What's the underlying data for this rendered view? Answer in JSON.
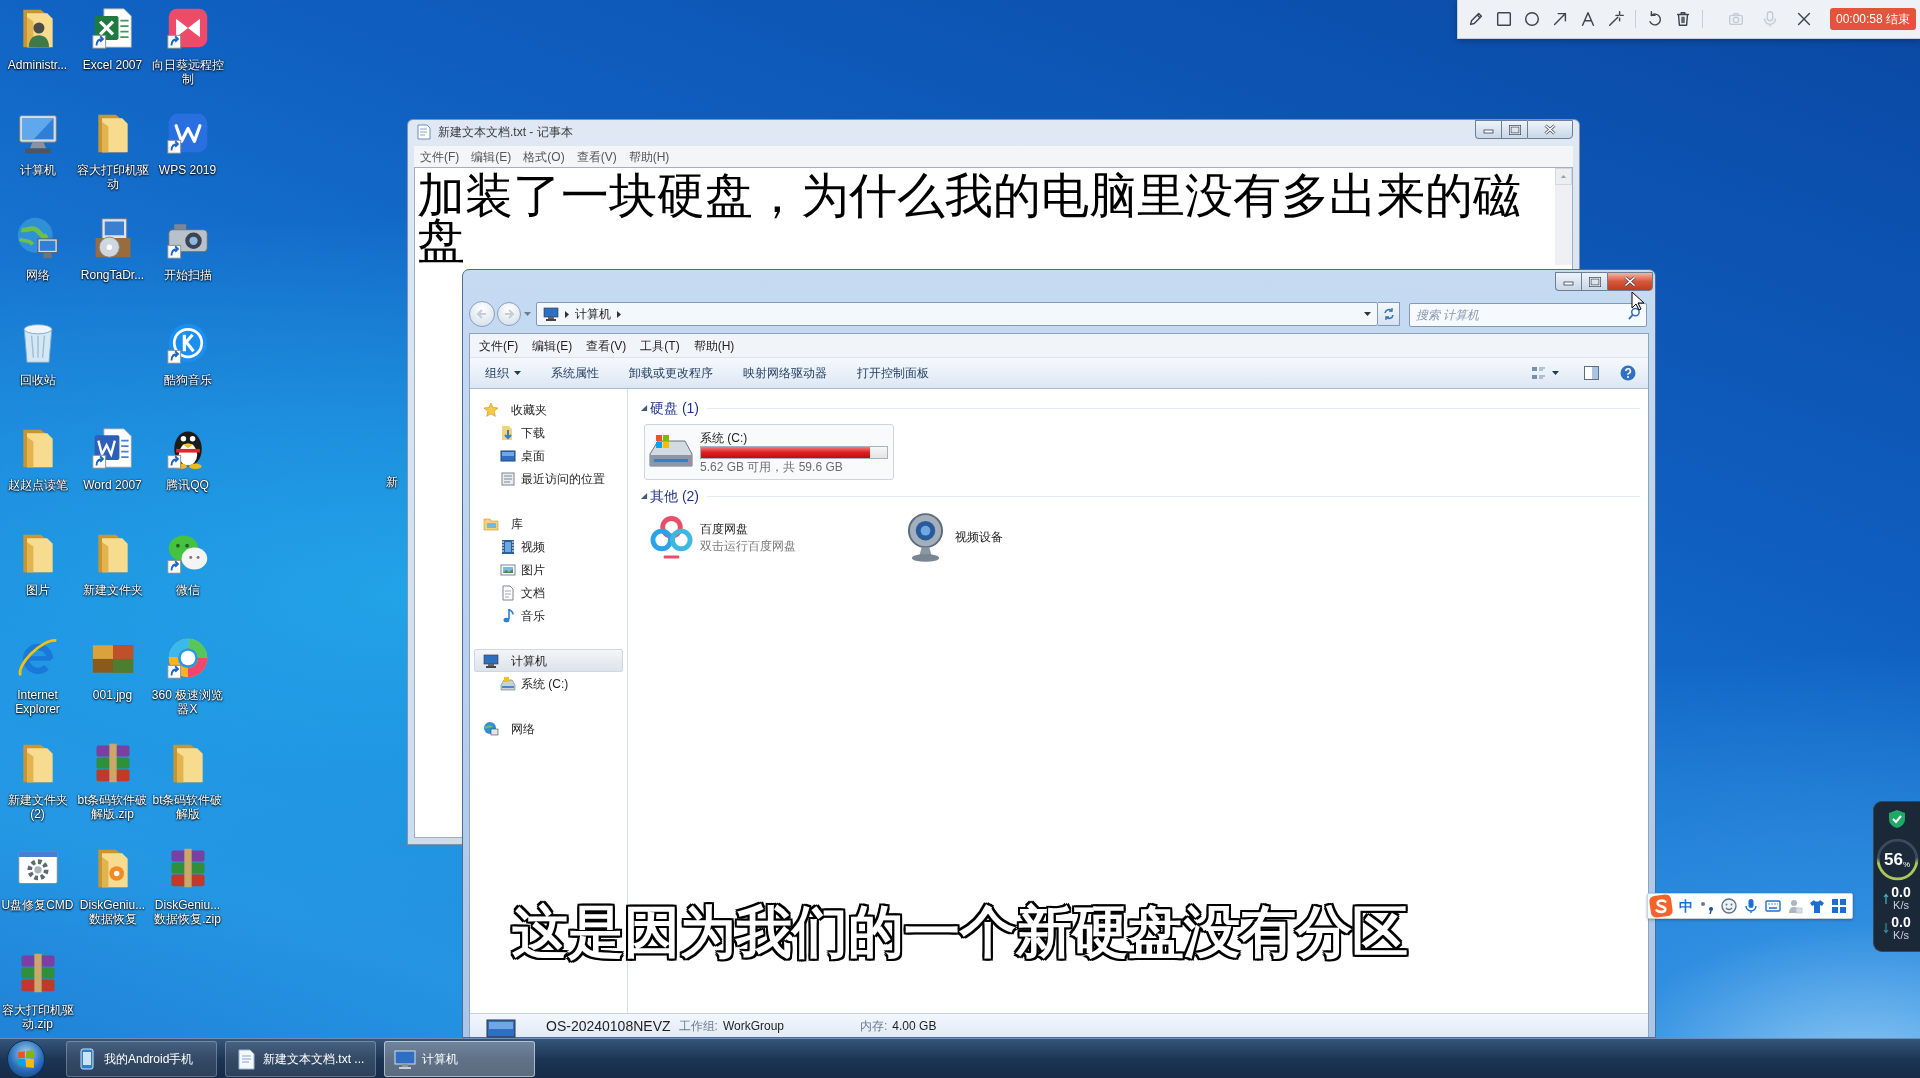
{
  "recorder_toolbar": {
    "tool_groups": [
      [
        {
          "kind": "pencil",
          "disabled": false
        },
        {
          "kind": "rectangle",
          "disabled": false
        },
        {
          "kind": "ellipse",
          "disabled": false
        },
        {
          "kind": "arrow",
          "disabled": false
        },
        {
          "kind": "text",
          "disabled": false
        },
        {
          "kind": "wand",
          "disabled": false
        }
      ],
      [
        {
          "kind": "undo",
          "disabled": false
        },
        {
          "kind": "trash",
          "disabled": false
        }
      ],
      [
        {
          "kind": "camera",
          "disabled": true
        },
        {
          "kind": "microphone",
          "disabled": true
        },
        {
          "kind": "close",
          "disabled": false
        }
      ]
    ],
    "timer_button": "00:00:58 结束"
  },
  "desktop_icon_rows": [
    [
      {
        "label": "Administr...",
        "kind": "user-folder",
        "shortcut": false
      },
      {
        "label": "Excel 2007",
        "kind": "excel",
        "shortcut": true
      },
      {
        "label": "向日葵远程控制",
        "kind": "remote",
        "shortcut": true
      }
    ],
    [
      {
        "label": "计算机",
        "kind": "computer",
        "shortcut": false
      },
      {
        "label": "容大打印机驱动",
        "kind": "folder",
        "shortcut": false
      },
      {
        "label": "WPS 2019",
        "kind": "wps",
        "shortcut": true
      }
    ],
    [
      {
        "label": "网络",
        "kind": "network",
        "shortcut": false
      },
      {
        "label": "RongTaDr...",
        "kind": "installer",
        "shortcut": false
      },
      {
        "label": "开始扫描",
        "kind": "scanner",
        "shortcut": true
      }
    ],
    [
      {
        "label": "回收站",
        "kind": "recycle-bin",
        "shortcut": false
      },
      {
        "kind": "empty"
      },
      {
        "label": "酷狗音乐",
        "kind": "music",
        "shortcut": true
      }
    ],
    [
      {
        "label": "赵赵点读笔",
        "kind": "folder",
        "shortcut": false
      },
      {
        "label": "Word 2007",
        "kind": "word",
        "shortcut": true
      },
      {
        "label": "腾讯QQ",
        "kind": "penguin",
        "shortcut": true
      }
    ],
    [
      {
        "label": "图片",
        "kind": "folder",
        "shortcut": false
      },
      {
        "label": "新建文件夹",
        "kind": "folder",
        "shortcut": false
      },
      {
        "label": "微信",
        "kind": "chat",
        "shortcut": true
      }
    ],
    [
      {
        "label": "Internet Explorer",
        "kind": "ie",
        "shortcut": false
      },
      {
        "label": "001.jpg",
        "kind": "photo",
        "shortcut": false
      },
      {
        "label": "360 极速浏览器X",
        "kind": "ring-browser",
        "shortcut": true
      }
    ],
    [
      {
        "label": "新建文件夹 (2)",
        "kind": "folder",
        "shortcut": false
      },
      {
        "label": "bt条码软件破解版.zip",
        "kind": "archive",
        "shortcut": false
      },
      {
        "label": "bt条码软件破解版",
        "kind": "folder",
        "shortcut": false
      }
    ],
    [
      {
        "label": "U盘修复CMD",
        "kind": "cmd",
        "shortcut": false
      },
      {
        "label": "DiskGeniu... 数据恢复",
        "kind": "disk-folder",
        "shortcut": false
      },
      {
        "label": "DiskGeniu... 数据恢复.zip",
        "kind": "archive",
        "shortcut": false
      }
    ],
    [
      {
        "label": "容大打印机驱动.zip",
        "kind": "archive",
        "shortcut": false
      }
    ]
  ],
  "partial_desktop_label": "新",
  "notepad": {
    "title": "新建文本文档.txt - 记事本",
    "active": false,
    "menu": [
      "文件(F)",
      "编辑(E)",
      "格式(O)",
      "查看(V)",
      "帮助(H)"
    ],
    "text": "加装了一块硬盘，为什么我的电脑里没有多出来的磁盘"
  },
  "explorer": {
    "active": true,
    "address": {
      "crumbs": [
        "计算机"
      ]
    },
    "search": {
      "placeholder": "搜索 计算机"
    },
    "menu": [
      "文件(F)",
      "编辑(E)",
      "查看(V)",
      "工具(T)",
      "帮助(H)"
    ],
    "commands": [
      {
        "label": "组织",
        "dropdown": true
      },
      {
        "label": "系统属性",
        "dropdown": false
      },
      {
        "label": "卸载或更改程序",
        "dropdown": false
      },
      {
        "label": "映射网络驱动器",
        "dropdown": false
      },
      {
        "label": "打开控制面板",
        "dropdown": false
      }
    ],
    "nav": [
      {
        "label": "收藏夹",
        "kind": "star",
        "selected": false,
        "children": [
          {
            "label": "下载",
            "kind": "download",
            "selected": false
          },
          {
            "label": "桌面",
            "kind": "desktop",
            "selected": false
          },
          {
            "label": "最近访问的位置",
            "kind": "recent",
            "selected": false
          }
        ]
      },
      {
        "label": "库",
        "kind": "library",
        "selected": false,
        "children": [
          {
            "label": "视频",
            "kind": "video",
            "selected": false
          },
          {
            "label": "图片",
            "kind": "pictures",
            "selected": false
          },
          {
            "label": "文档",
            "kind": "documents",
            "selected": false
          },
          {
            "label": "音乐",
            "kind": "music",
            "selected": false
          }
        ]
      },
      {
        "label": "计算机",
        "kind": "computer",
        "selected": true,
        "children": [
          {
            "label": "系统 (C:)",
            "kind": "drive",
            "selected": false
          }
        ]
      },
      {
        "label": "网络",
        "kind": "network",
        "selected": false
      }
    ],
    "groups": [
      {
        "title": "硬盘 (1)",
        "expanded": true,
        "items": [
          {
            "kind": "drive",
            "name": "系统 (C:)",
            "selected": true,
            "level": 0.906,
            "detail": "5.62 GB 可用，共 59.6 GB"
          }
        ]
      },
      {
        "title": "其他 (2)",
        "expanded": true,
        "items": [
          {
            "kind": "cloud",
            "name": "百度网盘",
            "selected": false,
            "detail": "双击运行百度网盘"
          },
          {
            "kind": "webcam",
            "name": "视频设备",
            "selected": false
          }
        ]
      }
    ],
    "details": {
      "computer_name": "OS-20240108NEVZ",
      "fields": [
        {
          "label": "工作组:",
          "value": "WorkGroup"
        },
        {
          "label": "内存:",
          "value": "4.00 GB"
        }
      ]
    }
  },
  "subtitle": "这是因为我们的一个新硬盘没有分区",
  "ime_bar": {
    "mode": "中"
  },
  "net_widget": {
    "reading": "56$_{%}$",
    "rates": [
      {
        "kind": "upload",
        "value": "0.0",
        "unit": "K/s"
      },
      {
        "kind": "download",
        "value": "0.0",
        "unit": "K/s"
      }
    ]
  },
  "taskbar": {
    "buttons": [
      {
        "label": "我的Android手机",
        "kind": "phone",
        "selected": false
      },
      {
        "label": "新建文本文档.txt ...",
        "kind": "notepad",
        "selected": false
      },
      {
        "label": "计算机",
        "kind": "computer",
        "selected": true
      }
    ]
  }
}
